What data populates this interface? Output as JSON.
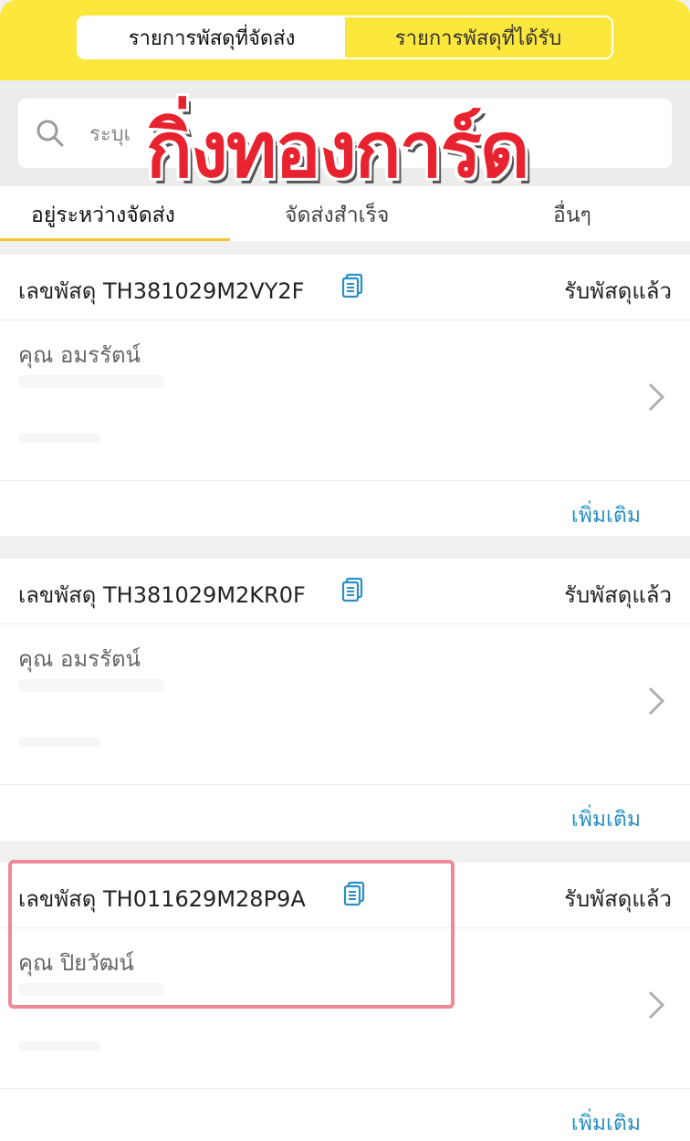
{
  "header": {
    "seg_sent": "รายการพัสดุที่จัดส่ง",
    "seg_received": "รายการพัสดุที่ได้รับ"
  },
  "search": {
    "placeholder": "ระบุเ",
    "icon": "search-icon"
  },
  "watermark": "กิ่งทองการ์ด",
  "tabs": [
    {
      "label": "อยู่ระหว่างจัดส่ง",
      "active": true
    },
    {
      "label": "จัดส่งสำเร็จ"
    },
    {
      "label": "อื่นๆ"
    }
  ],
  "shipments": [
    {
      "tracking": "เลขพัสดุ TH381029M2VY2F",
      "status": "รับพัสดุแล้ว",
      "recipient": "คุณ อมรรัตน์",
      "more": "เพิ่มเติม"
    },
    {
      "tracking": "เลขพัสดุ TH381029M2KR0F",
      "status": "รับพัสดุแล้ว",
      "recipient": "คุณ อมรรัตน์",
      "more": "เพิ่มเติม"
    },
    {
      "tracking": "เลขพัสดุ TH011629M28P9A",
      "status": "รับพัสดุแล้ว",
      "recipient": "คุณ ปิยวัฒน์",
      "more": "เพิ่มเติม"
    }
  ],
  "colors": {
    "accent_yellow": "#fce73c",
    "link_blue": "#2a90c4",
    "highlight_pink": "#f08898",
    "watermark_red": "#e8222e"
  }
}
